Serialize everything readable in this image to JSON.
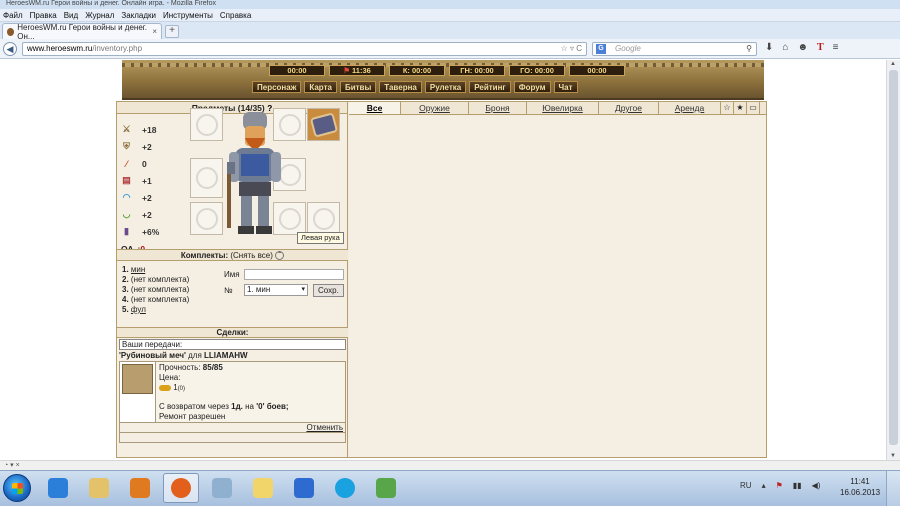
{
  "window": {
    "title": "HeroesWM.ru Герои войны и денег. Онлайн игра. - Mozilla Firefox"
  },
  "menu": [
    "Файл",
    "Правка",
    "Вид",
    "Журнал",
    "Закладки",
    "Инструменты",
    "Справка"
  ],
  "tab": {
    "label": "HeroesWM.ru Герои войны и денег. Он...",
    "close": "×",
    "new": "+"
  },
  "address": {
    "host": "www.heroeswm.ru",
    "path": "/inventory.php",
    "icons": "☆ ▿ C"
  },
  "search": {
    "engine": "G",
    "placeholder": "Google",
    "icon": "⚲"
  },
  "toolbar_icons": [
    "download-icon",
    "home-icon",
    "addon-icon",
    "translate-icon",
    "menu-icon"
  ],
  "timers": [
    {
      "label": "",
      "value": "00:00"
    },
    {
      "label": "",
      "value": "11:36",
      "flag": "red"
    },
    {
      "label": "К:",
      "value": "00:00"
    },
    {
      "label": "ГН:",
      "value": "00:00"
    },
    {
      "label": "ГО:",
      "value": "00:00"
    },
    {
      "label": "",
      "value": "00:00"
    }
  ],
  "topnav": [
    "Персонаж",
    "Карта",
    "Битвы",
    "Таверна",
    "Рулетка",
    "Рейтинг",
    "Форум",
    "Чат"
  ],
  "inventory": {
    "header": "Предметы (14/35)",
    "help": "?",
    "stats": [
      {
        "icon": "attack-icon",
        "value": "+18",
        "color": "#8a6d3b"
      },
      {
        "icon": "defense-icon",
        "value": "+2",
        "color": "#8a6d3b"
      },
      {
        "icon": "magic-wand-icon",
        "value": "0",
        "color": "#c9481f"
      },
      {
        "icon": "knowledge-book-icon",
        "value": "+1",
        "color": "#b13b3b"
      },
      {
        "icon": "luck-rainbow-icon",
        "value": "+2",
        "color": "#3a9ad9"
      },
      {
        "icon": "morale-icon",
        "value": "+2",
        "color": "#5aa02c"
      },
      {
        "icon": "initiative-icon",
        "value": "+6%",
        "color": "#6a4a8a"
      }
    ],
    "oa_label": "ОА",
    "oa_value": "0",
    "tooltip": "Левая рука"
  },
  "kits": {
    "header": "Комплекты:",
    "remove_all": "(Снять все)",
    "collapse": "⌃",
    "list": [
      {
        "num": "1.",
        "name": "мин",
        "link": true
      },
      {
        "num": "2.",
        "name": "(нет комплекта)",
        "link": false
      },
      {
        "num": "3.",
        "name": "(нет комплекта)",
        "link": false
      },
      {
        "num": "4.",
        "name": "(нет комплекта)",
        "link": false
      },
      {
        "num": "5.",
        "name": "фул",
        "link": true
      }
    ],
    "name_label": "Имя",
    "name_value": "",
    "num_label": "№",
    "selected": "1. мин",
    "save": "Сохр."
  },
  "deals": {
    "header": "Сделки:",
    "transfers_label": "Ваши передачи:",
    "item_name": "'Рубиновый меч'",
    "for_label": "для",
    "recipient": "LLIAMAHW",
    "durability_label": "Прочность:",
    "durability": "85/85",
    "price_label": "Цена:",
    "price": "1",
    "price_sub": "(0)",
    "return_text": "С возвратом через",
    "return_days": "1д.",
    "return_mid": "на",
    "return_battles": "'0' боев;",
    "repair": "Ремонт разрешен",
    "cancel": "Отменить"
  },
  "filters": {
    "tabs": [
      "Все",
      "Оружие",
      "Броня",
      "Ювелирка",
      "Другое",
      "Аренда"
    ],
    "active": "Все",
    "icons": [
      "star-outline-icon",
      "star-icon",
      "chest-icon"
    ]
  },
  "statusbar": {
    "text": "◔ ▾  ×"
  },
  "taskbar": {
    "apps": [
      {
        "name": "ie",
        "color": "#2c7fd9"
      },
      {
        "name": "explorer",
        "color": "#e3c26a"
      },
      {
        "name": "media-player",
        "color": "#e07a20"
      },
      {
        "name": "firefox",
        "color": "#e2601c",
        "active": true
      },
      {
        "name": "calculator",
        "color": "#8fb0cf"
      },
      {
        "name": "folder",
        "color": "#f1d46a"
      },
      {
        "name": "ccleaner",
        "color": "#2e6bd1"
      },
      {
        "name": "skype",
        "color": "#1aa1e0"
      },
      {
        "name": "network",
        "color": "#59a54a"
      }
    ],
    "lang": "RU",
    "time": "11:41",
    "date": "16.06.2013"
  }
}
